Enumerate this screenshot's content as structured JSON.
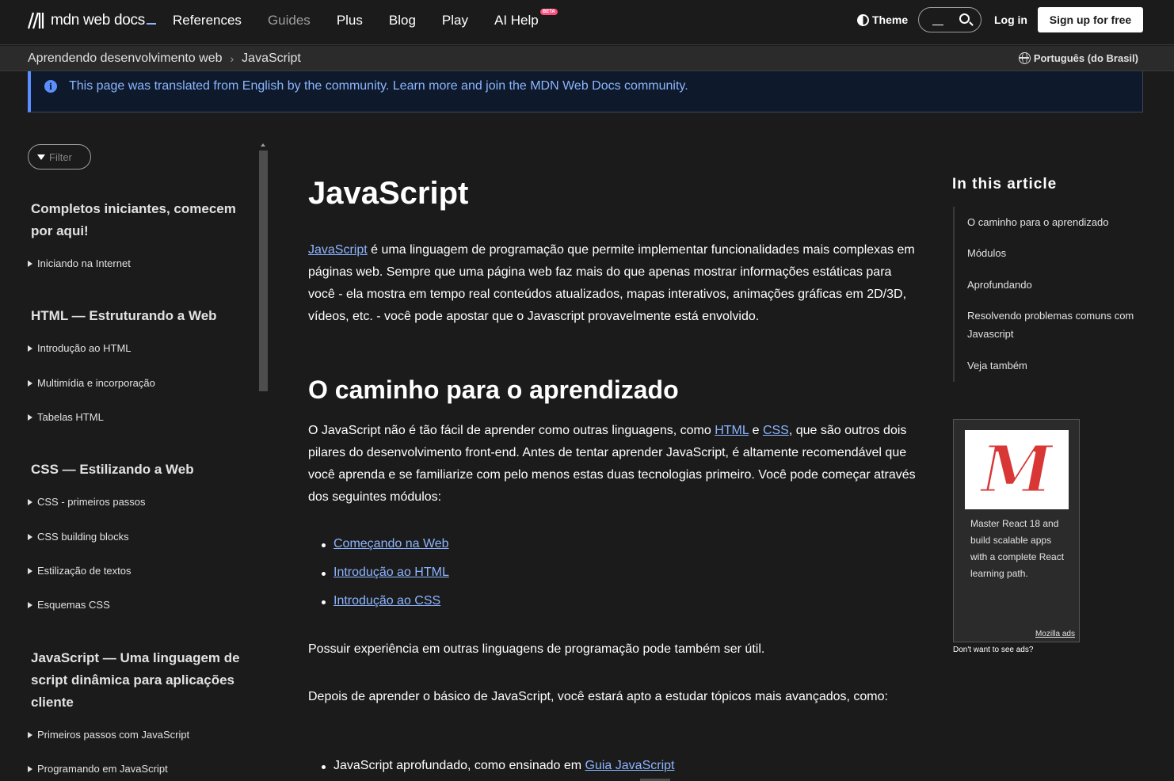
{
  "nav": {
    "logo_text": "mdn web docs",
    "items": [
      "References",
      "Guides",
      "Plus",
      "Blog",
      "Play",
      "AI Help"
    ],
    "beta_badge": "BETA",
    "theme_label": "Theme",
    "login_label": "Log in",
    "signup_label": "Sign up for free"
  },
  "breadcrumb": {
    "items": [
      "Aprendendo desenvolvimento web",
      "JavaScript"
    ],
    "separator": "›",
    "language": "Português (do Brasil)"
  },
  "notice": {
    "icon": "info-icon",
    "text": "This page was translated from English by the community. Learn more and join the MDN Web Docs community."
  },
  "sidebar": {
    "filter_placeholder": "Filter",
    "sections": [
      {
        "heading": "Completos iniciantes, comecem por aqui!",
        "items": [
          "Iniciando na Internet"
        ]
      },
      {
        "heading": "HTML — Estruturando a Web",
        "items": [
          "Introdução ao HTML",
          "Multimídia e incorporação",
          "Tabelas HTML"
        ]
      },
      {
        "heading": "CSS — Estilizando a Web",
        "items": [
          "CSS - primeiros passos",
          "CSS building blocks",
          "Estilização de textos",
          "Esquemas CSS"
        ]
      },
      {
        "heading": "JavaScript — Uma linguagem de script dinâmica para aplicações cliente",
        "items": [
          "Primeiros passos com JavaScript",
          "Programando em JavaScript"
        ]
      }
    ]
  },
  "main": {
    "title": "JavaScript",
    "intro_link": "JavaScript",
    "intro_text": " é uma linguagem de programação que permite implementar funcionalidades mais complexas em páginas web. Sempre que uma página web faz mais do que apenas mostrar informações estáticas para você - ela mostra em tempo real conteúdos atualizados, mapas interativos, animações gráficas em 2D/3D, vídeos, etc. - você pode apostar que o Javascript provavelmente está envolvido.",
    "h2": "O caminho para o aprendizado",
    "p2_a": "O JavaScript não é tão fácil de aprender como outras linguagens, como ",
    "p2_link1": "HTML",
    "p2_b": " e ",
    "p2_link2": "CSS",
    "p2_c": ", que são outros dois pilares do desenvolvimento front-end. Antes de tentar aprender JavaScript, é altamente recomendável que você aprenda e se familiarize com pelo menos estas duas tecnologias primeiro. Você pode começar através dos seguintes módulos:",
    "modules": [
      "Começando na Web",
      "Introdução ao HTML",
      "Introdução ao CSS"
    ],
    "p3": "Possuir experiência em outras linguagens de programação pode também ser útil.",
    "p4": "Depois de aprender o básico de JavaScript, você estará apto a estudar tópicos mais avançados, como:",
    "advanced_prefix": "JavaScript aprofundado, como ensinado em ",
    "advanced_link": "Guia JavaScript"
  },
  "toc": {
    "title": "In this article",
    "items": [
      "O caminho para o aprendizado",
      "Módulos",
      "Aprofundando",
      "Resolvendo problemas comuns com Javascript",
      "Veja também"
    ]
  },
  "ad": {
    "image_letter": "M",
    "text": "Master React 18 and build scalable apps with a complete React learning path.",
    "by": "Mozilla ads",
    "no_ads": "Don't want to see ads?"
  },
  "colors": {
    "background": "#1b1b1b",
    "link": "#8cb4ff",
    "notice_accent": "#5b8fff",
    "beta": "#ff4d7d",
    "ad_logo": "#d93636"
  }
}
